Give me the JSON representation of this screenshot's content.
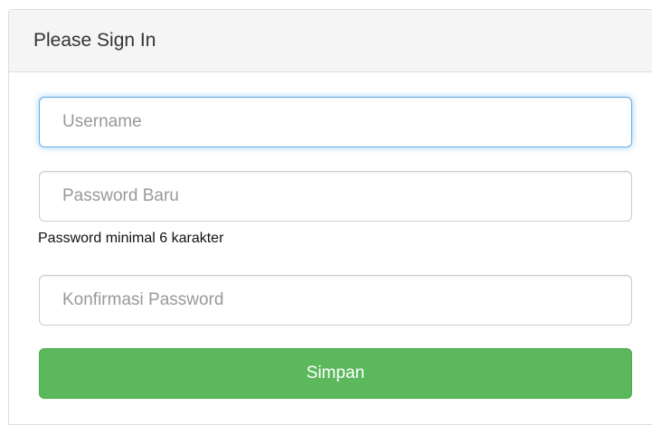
{
  "panel": {
    "title": "Please Sign In"
  },
  "form": {
    "username": {
      "placeholder": "Username",
      "value": ""
    },
    "password": {
      "placeholder": "Password Baru",
      "value": "",
      "help": "Password minimal 6 karakter"
    },
    "confirm_password": {
      "placeholder": "Konfirmasi Password",
      "value": ""
    },
    "submit_label": "Simpan"
  },
  "colors": {
    "heading_bg": "#f5f5f5",
    "focus_border": "#66afe9",
    "button_bg": "#5cb85c"
  }
}
